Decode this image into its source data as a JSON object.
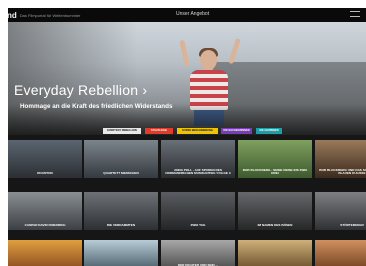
{
  "header": {
    "logo": "nd",
    "tagline": "Das Filmportal für Weltenbummler",
    "center_label": "Unser Angebot",
    "menu_icon": "hamburger-icon"
  },
  "hero": {
    "title": "Everyday Rebellion",
    "title_arrow": "›",
    "subtitle": "Hommage an die Kraft des friedlichen Widerstands",
    "chips": [
      {
        "label": "EVERYDAY REBELLION",
        "bg": "#e8e8e8",
        "fg": "#111111"
      },
      {
        "label": "STAATLICHE",
        "bg": "#e23b2b",
        "fg": "#ffffff"
      },
      {
        "label": "KURZE BESCHREIBUNG",
        "bg": "#f0c400",
        "fg": "#111111"
      },
      {
        "label": "DIE NACHBARINNEN",
        "bg": "#7a3db8",
        "fg": "#ffffff"
      },
      {
        "label": "DIE GEWINNER",
        "bg": "#1aa0a8",
        "fg": "#ffffff"
      }
    ]
  },
  "rows": [
    [
      {
        "caption": "ROUNTON"
      },
      {
        "caption": "QUARTETT MENSCHEN"
      },
      {
        "caption": "ANNA POLL - AUF SPUREN DES NORMANNISCHEN MUSIKANTEN / FOLGE 3"
      },
      {
        "caption": "BOB BLOCKBERG - SEINE REISE INS ZWEI DREI"
      },
      {
        "caption": "BOB BLOCKBERG UND DAS SCHWEIN DER BLAUEN KULISSE"
      }
    ],
    [
      {
        "caption": "CASPAR DAVID FRIEDRICH"
      },
      {
        "caption": "DIE VERDAMMTEN"
      },
      {
        "caption": "ZWEI TAG"
      },
      {
        "caption": "IM NAMEN DES BÖSEN"
      },
      {
        "caption": "STÖRTEBEKER"
      }
    ],
    [
      {
        "caption": ""
      },
      {
        "caption": ""
      },
      {
        "caption": "DER DICHTER UND SEIN ..."
      },
      {
        "caption": ""
      },
      {
        "caption": ""
      }
    ]
  ]
}
